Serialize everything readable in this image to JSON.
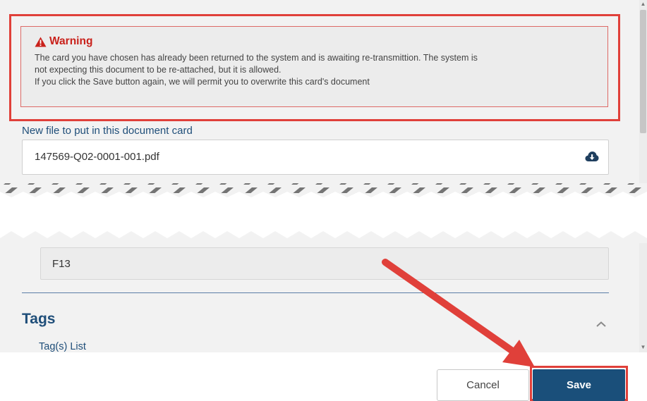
{
  "warning": {
    "title": "Warning",
    "line1": "The card you have chosen has already been returned to the system and is awaiting re-transmittion. The system is",
    "line2": "not expecting this document to be re-attached, but it is allowed.",
    "line3": "If you click the Save button again, we will permit you to overwrite this card's document"
  },
  "new_file": {
    "label": "New file to put in this document card",
    "value": "147569-Q02-0001-001.pdf"
  },
  "field_value": "F13",
  "tags": {
    "title": "Tags",
    "list_label": "Tag(s) List"
  },
  "buttons": {
    "cancel": "Cancel",
    "save": "Save"
  },
  "colors": {
    "accent": "#1a4f7a",
    "annotation_red": "#e0403a",
    "warning_red": "#c9211b"
  }
}
